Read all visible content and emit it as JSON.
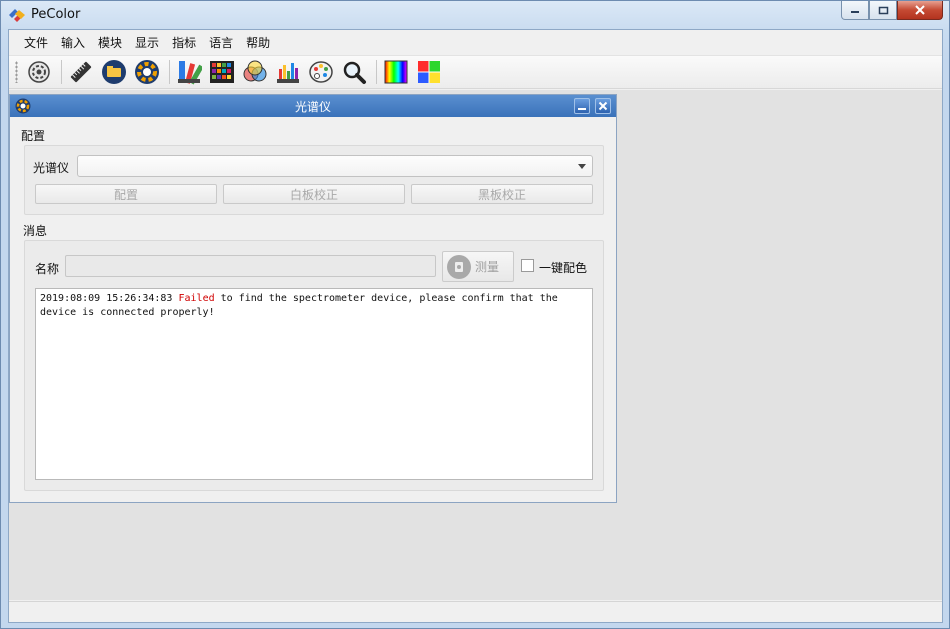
{
  "window": {
    "title": "PeColor"
  },
  "menu": [
    "文件",
    "输入",
    "模块",
    "显示",
    "指标",
    "语言",
    "帮助"
  ],
  "toolbar": {
    "icons": [
      "settings-gear-icon",
      "ruler-icon",
      "folder-open-icon",
      "color-wheel-icon",
      "color-fan-icon",
      "color-grid-icon",
      "rgb-circles-icon",
      "color-bars-icon",
      "palette-icon",
      "magnifier-icon",
      "spectrum-icon",
      "color-square-icon"
    ]
  },
  "child_window": {
    "title": "光谱仪",
    "config_section": {
      "label": "配置",
      "device_label": "光谱仪",
      "device_value": "",
      "buttons": [
        "配置",
        "白板校正",
        "黑板校正"
      ]
    },
    "message_section": {
      "label": "消息",
      "name_label": "名称",
      "name_value": "",
      "measure_label": "测量",
      "auto_match_label": "一键配色",
      "auto_match_checked": false,
      "log": {
        "timestamp": "2019:08:09 15:26:34:83",
        "status": "Failed",
        "message": "to find the spectrometer device, please confirm that the device is connected properly!"
      }
    }
  },
  "colors": {
    "title_blue": "#3a72ba",
    "fail_red": "#d00000",
    "close_red": "#c54a33"
  }
}
